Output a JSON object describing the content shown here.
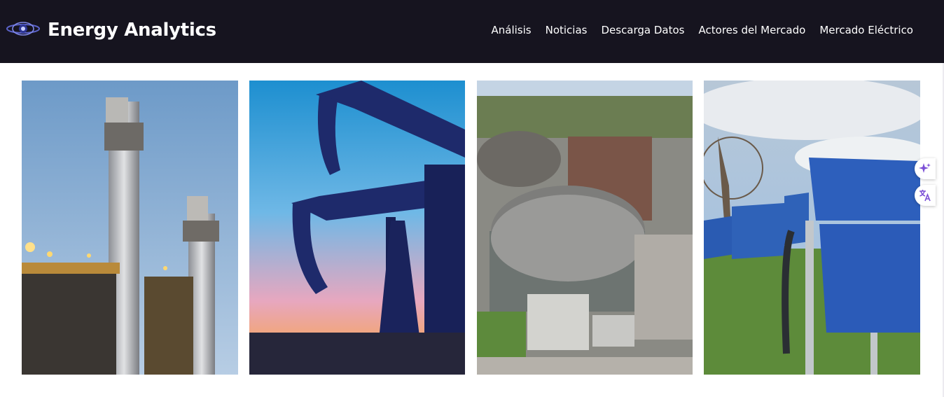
{
  "header": {
    "brand": "Energy Analytics",
    "logo_icon": "galaxy-logo-icon",
    "nav": [
      {
        "label": "Análisis"
      },
      {
        "label": "Noticias"
      },
      {
        "label": "Descarga Datos"
      },
      {
        "label": "Actores del Mercado"
      },
      {
        "label": "Mercado Eléctrico"
      }
    ]
  },
  "gallery": [
    {
      "subject": "power-plant-chimneys"
    },
    {
      "subject": "oil-pumpjack-sunset"
    },
    {
      "subject": "nuclear-plant-domes"
    },
    {
      "subject": "solar-panels-field"
    }
  ],
  "side_tools": [
    {
      "icon": "sparkle-ai-icon"
    },
    {
      "icon": "translate-icon"
    }
  ],
  "colors": {
    "navbar_bg": "#16141f",
    "nav_text": "#ffffff",
    "tool_accent": "#7b4fd6"
  }
}
